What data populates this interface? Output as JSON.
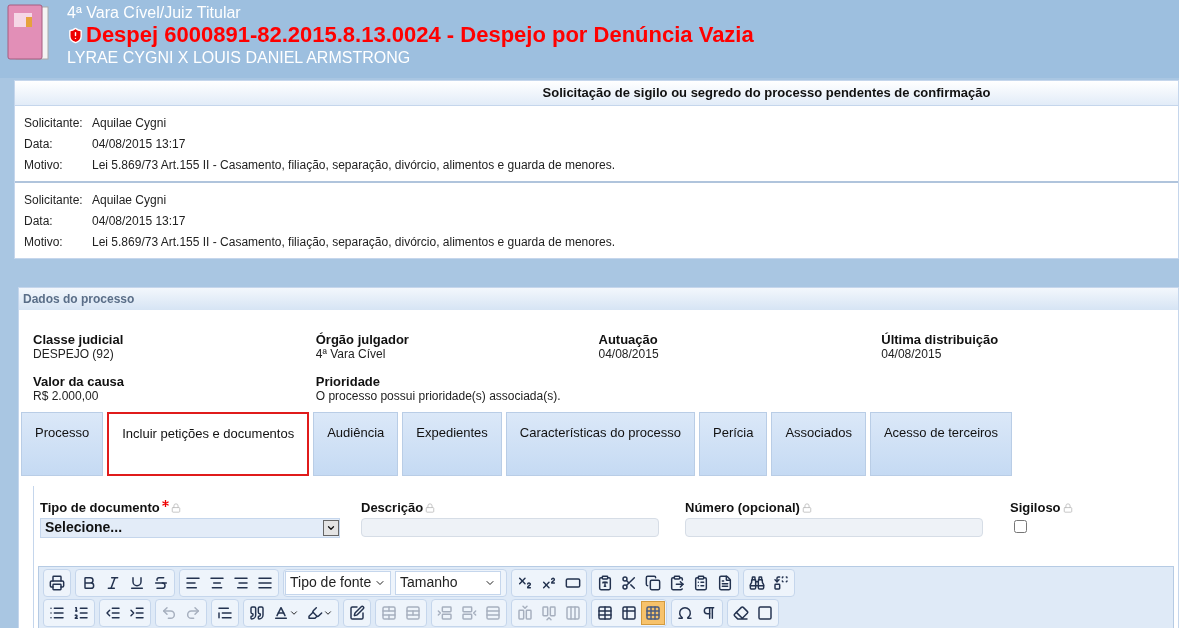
{
  "header": {
    "subtitle": "4ª Vara Cível/Juiz Titular",
    "title": "Despej 6000891-82.2015.8.13.0024 - Despejo por Denúncia Vazia",
    "parties": "LYRAE CYGNI X LOUIS DANIEL ARMSTRONG",
    "secret": true
  },
  "requests": {
    "title": "Solicitação de sigilo ou segredo do processo pendentes de confirmação",
    "entries": [
      [
        {
          "label": "Solicitante:",
          "value": "Aquilae Cygni"
        },
        {
          "label": "Data:",
          "value": "04/08/2015 13:17"
        },
        {
          "label": "Motivo:",
          "value": "Lei 5.869/73 Art.155 II - Casamento, filiação, separação, divórcio, alimentos e guarda de menores."
        }
      ],
      [
        {
          "label": "Solicitante:",
          "value": "Aquilae Cygni"
        },
        {
          "label": "Data:",
          "value": "04/08/2015 13:17"
        },
        {
          "label": "Motivo:",
          "value": "Lei 5.869/73 Art.155 II - Casamento, filiação, separação, divórcio, alimentos e guarda de menores."
        }
      ]
    ]
  },
  "process": {
    "title": "Dados do processo",
    "fields": [
      {
        "label": "Classe judicial",
        "value": "DESPEJO (92)"
      },
      {
        "label": "Órgão julgador",
        "value": "4ª Vara Cível"
      },
      {
        "label": "Autuação",
        "value": "04/08/2015"
      },
      {
        "label": "Última distribuição",
        "value": "04/08/2015"
      },
      {
        "label": "Valor da causa",
        "value": "R$ 2.000,00"
      },
      {
        "label": "Prioridade",
        "value": "O processo possui prioridade(s) associada(s)."
      }
    ]
  },
  "tabs": [
    {
      "label": "Processo",
      "selected": false
    },
    {
      "label": "Incluir petições e documentos",
      "selected": true
    },
    {
      "label": "Audiência",
      "selected": false
    },
    {
      "label": "Expedientes",
      "selected": false
    },
    {
      "label": "Características do processo",
      "selected": false
    },
    {
      "label": "Perícia",
      "selected": false
    },
    {
      "label": "Associados",
      "selected": false
    },
    {
      "label": "Acesso de terceiros",
      "selected": false
    }
  ],
  "form": {
    "fields": [
      {
        "kind": "select",
        "label": "Tipo de documento",
        "required": true,
        "value": "Selecione..."
      },
      {
        "kind": "text",
        "label": "Descrição",
        "required": false
      },
      {
        "kind": "text",
        "label": "Número (opcional)",
        "required": false
      },
      {
        "kind": "checkbox",
        "label": "Sigiloso",
        "required": false,
        "checked": false
      }
    ]
  },
  "toolbar": [
    [
      [
        {
          "disabled": false,
          "selected": false
        }
      ],
      [
        {
          "disabled": false,
          "selected": false
        },
        {
          "disabled": false,
          "selected": false
        },
        {
          "disabled": false,
          "selected": false
        },
        {
          "disabled": false,
          "selected": false
        }
      ],
      [
        {
          "disabled": false,
          "selected": false
        },
        {
          "disabled": false,
          "selected": false
        },
        {
          "disabled": false,
          "selected": false
        },
        {
          "disabled": false,
          "selected": false
        }
      ],
      [
        {
          "kind": "dropdown",
          "label": "Tipo de fonte"
        },
        {
          "kind": "dropdown",
          "label": "Tamanho"
        }
      ],
      [
        {
          "disabled": false,
          "selected": false
        },
        {
          "disabled": false,
          "selected": false
        },
        {
          "disabled": false,
          "selected": false
        }
      ],
      [
        {
          "disabled": false,
          "selected": false
        },
        {
          "disabled": false,
          "selected": false
        },
        {
          "disabled": false,
          "selected": false
        },
        {
          "disabled": false,
          "selected": false
        },
        {
          "disabled": false,
          "selected": false
        },
        {
          "disabled": false,
          "selected": false
        }
      ],
      [
        {
          "disabled": false,
          "selected": false
        },
        {
          "disabled": false,
          "selected": false
        }
      ]
    ],
    [
      [
        {
          "disabled": false,
          "selected": false
        },
        {
          "disabled": false,
          "selected": false
        }
      ],
      [
        {
          "disabled": false,
          "selected": false
        },
        {
          "disabled": false,
          "selected": false
        }
      ],
      [
        {
          "disabled": true,
          "selected": false
        },
        {
          "disabled": true,
          "selected": false
        }
      ],
      [
        {
          "disabled": false,
          "selected": false
        }
      ],
      [
        {
          "disabled": false,
          "selected": false
        },
        {
          "disabled": false,
          "selected": false
        },
        {
          "disabled": false,
          "selected": false
        }
      ],
      [
        {
          "disabled": false,
          "selected": false
        }
      ],
      [
        {
          "disabled": true,
          "selected": false
        },
        {
          "disabled": true,
          "selected": false
        }
      ],
      [
        {
          "disabled": true,
          "selected": false
        },
        {
          "disabled": true,
          "selected": false
        },
        {
          "disabled": true,
          "selected": false
        }
      ],
      [
        {
          "disabled": true,
          "selected": false
        },
        {
          "disabled": true,
          "selected": false
        },
        {
          "disabled": true,
          "selected": false
        }
      ],
      [
        {
          "disabled": false,
          "selected": false
        },
        {
          "disabled": false,
          "selected": false
        },
        {
          "disabled": false,
          "selected": true
        }
      ],
      [
        {
          "disabled": false,
          "selected": false
        },
        {
          "disabled": false,
          "selected": false
        }
      ],
      [
        {
          "disabled": false,
          "selected": false
        },
        {
          "disabled": false,
          "selected": false
        }
      ]
    ]
  ]
}
